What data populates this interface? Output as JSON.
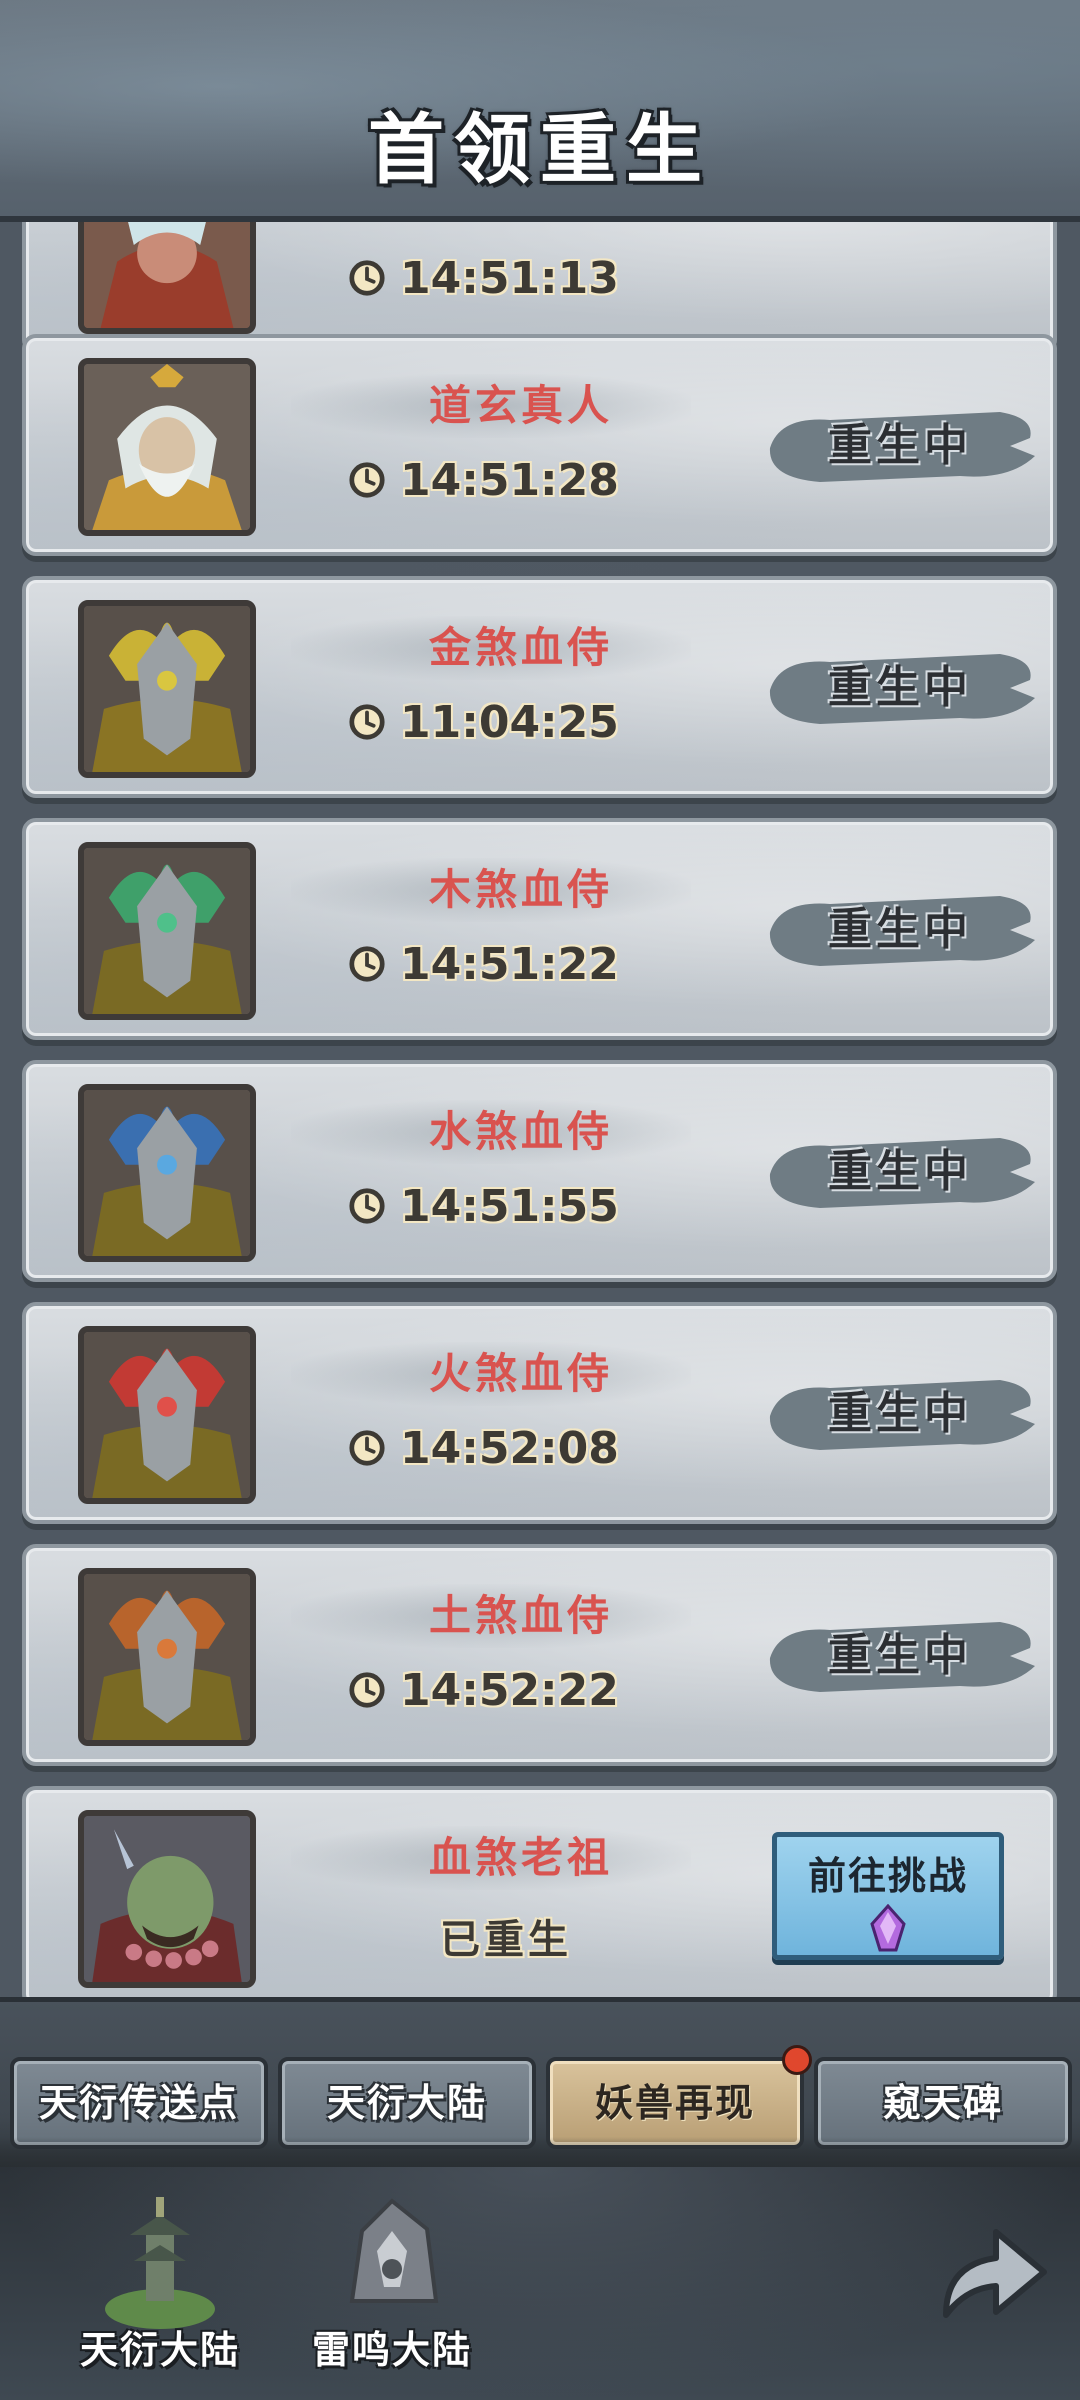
{
  "header": {
    "title": "首领重生"
  },
  "partial_card": {
    "time": "14:51:13"
  },
  "bosses": [
    {
      "name": "道玄真人",
      "time": "14:51:28",
      "status": "重生中",
      "portrait": "white-bearded-sage"
    },
    {
      "name": "金煞血侍",
      "time": "11:04:25",
      "status": "重生中",
      "portrait": "gold-armored-guard"
    },
    {
      "name": "木煞血侍",
      "time": "14:51:22",
      "status": "重生中",
      "portrait": "green-armored-guard"
    },
    {
      "name": "水煞血侍",
      "time": "14:51:55",
      "status": "重生中",
      "portrait": "blue-armored-guard"
    },
    {
      "name": "火煞血侍",
      "time": "14:52:08",
      "status": "重生中",
      "portrait": "red-armored-guard"
    },
    {
      "name": "土煞血侍",
      "time": "14:52:22",
      "status": "重生中",
      "portrait": "orange-armored-guard"
    }
  ],
  "last_boss": {
    "name": "血煞老祖",
    "status": "已重生",
    "action_label": "前往挑战",
    "portrait": "green-ogre-elder"
  },
  "tabs": [
    {
      "label": "天衍传送点",
      "active": false
    },
    {
      "label": "天衍大陆",
      "active": false
    },
    {
      "label": "妖兽再现",
      "active": true,
      "has_notification": true
    },
    {
      "label": "窥天碑",
      "active": false
    }
  ],
  "nav": [
    {
      "label": "天衍大陆",
      "icon": "pagoda-icon"
    },
    {
      "label": "雷鸣大陆",
      "icon": "rock-crystal-icon"
    }
  ],
  "icons": {
    "timer": "clock-icon",
    "back": "back-arrow-icon"
  },
  "colors": {
    "boss_name": "#d9534f",
    "accent_gold": "#d9c39c",
    "challenge_blue": "#8cc6e8"
  }
}
